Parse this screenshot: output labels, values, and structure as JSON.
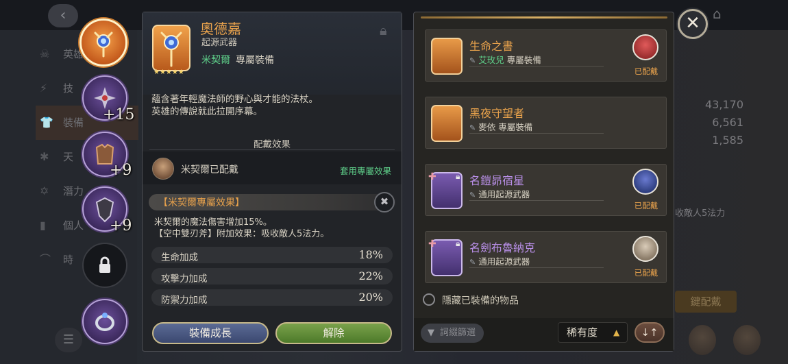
{
  "background": {
    "menu_items": [
      {
        "icon": "skull-icon",
        "label": "英雄"
      },
      {
        "icon": "bolt-icon",
        "label": "技"
      },
      {
        "icon": "shirt-icon",
        "label": "裝備"
      },
      {
        "icon": "star-icon",
        "label": "天"
      },
      {
        "icon": "hexagram-icon",
        "label": "潛力"
      },
      {
        "icon": "book-icon",
        "label": "個人"
      },
      {
        "icon": "hanger-icon",
        "label": "時"
      }
    ],
    "stats": [
      "43,170",
      "6,561",
      "1,585"
    ],
    "right_note": "收敵人5法力",
    "right_button": "鍵配戴"
  },
  "slots": [
    {
      "name": "staff-slot",
      "style": "orange",
      "level": ""
    },
    {
      "name": "blade-slot",
      "style": "purple",
      "level": "+15"
    },
    {
      "name": "armor-slot",
      "style": "purple",
      "level": "+9"
    },
    {
      "name": "shield-slot",
      "style": "purple",
      "level": "+9"
    },
    {
      "name": "locked-slot",
      "style": "dark",
      "level": ""
    },
    {
      "name": "ring-slot",
      "style": "purple",
      "level": ""
    }
  ],
  "detail": {
    "name": "奧德嘉",
    "type": "起源武器",
    "owner": "米契爾",
    "owner_suffix": "專屬裝備",
    "stars": "★★★★★",
    "description": [
      "蘊含著年輕魔法師的野心與才能的法杖。",
      "英雄的傳說就此拉開序幕。"
    ],
    "effect_section_title": "配戴效果",
    "equipped_text": "米契爾已配戴",
    "apply_exclusive": "套用專屬效果",
    "exclusive_title": "【米契爾專屬效果】",
    "exclusive_desc": [
      "米契爾的魔法傷害增加15%。",
      "【空中雙刃斧】附加效果：吸收敵人5法力。"
    ],
    "stats": [
      {
        "name": "生命加成",
        "value": "18%"
      },
      {
        "name": "攻擊力加成",
        "value": "22%"
      },
      {
        "name": "防禦力加成",
        "value": "20%"
      }
    ],
    "grow_button": "裝備成長",
    "unequip_button": "解除"
  },
  "list": {
    "items": [
      {
        "name": "生命之書",
        "color": "org",
        "tag": "✎",
        "owner": "艾玫兒",
        "suffix": "專屬裝備",
        "equipped": "已配戴",
        "has_avatar": true,
        "locked": false
      },
      {
        "name": "黑夜守望者",
        "color": "org",
        "tag": "✎",
        "owner": "",
        "suffix": "麥依 專屬裝備",
        "equipped": "",
        "has_avatar": false,
        "locked": false
      },
      {
        "name": "名鎧昴宿星",
        "color": "pur",
        "tag": "✎",
        "owner": "",
        "suffix": "通用起源武器",
        "equipped": "已配戴",
        "has_avatar": true,
        "locked": true
      },
      {
        "name": "名劍布魯納克",
        "color": "pur",
        "tag": "✎",
        "owner": "",
        "suffix": "通用起源武器",
        "equipped": "已配戴",
        "has_avatar": true,
        "locked": true
      }
    ],
    "hide_equipped": "隱藏已裝備的物品",
    "filter_label": "詞綴篩選",
    "sort_label": "稀有度",
    "order_label": "↓↑"
  },
  "colors": {
    "accent_orange": "#e8a24c",
    "accent_green": "#5fd08a",
    "accent_purple": "#b98fe8"
  }
}
